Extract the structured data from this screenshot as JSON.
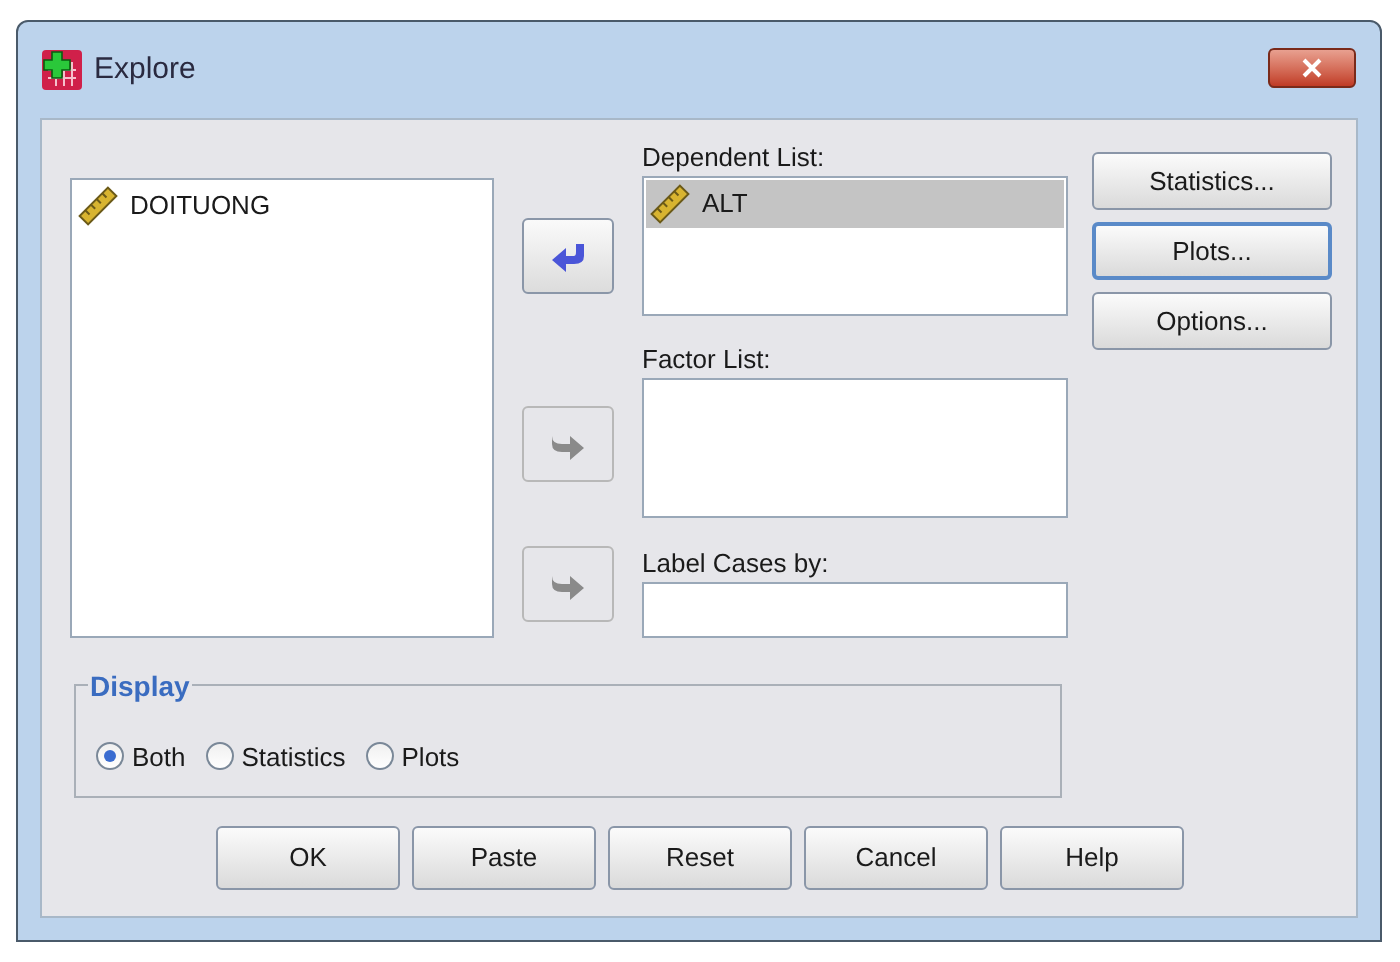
{
  "window": {
    "title": "Explore"
  },
  "source_list": {
    "items": [
      {
        "label": "DOITUONG",
        "selected": false
      }
    ]
  },
  "move_buttons": [
    {
      "kind": "back",
      "disabled": false
    },
    {
      "kind": "forward",
      "disabled": true
    },
    {
      "kind": "forward",
      "disabled": true
    }
  ],
  "dependent_list": {
    "label": "Dependent List:",
    "items": [
      {
        "label": "ALT",
        "selected": true
      }
    ]
  },
  "factor_list": {
    "label": "Factor List:"
  },
  "label_cases": {
    "label": "Label Cases by:"
  },
  "side_buttons": [
    {
      "label": "Statistics...",
      "focused": false
    },
    {
      "label": "Plots...",
      "focused": true
    },
    {
      "label": "Options...",
      "focused": false
    }
  ],
  "display": {
    "title": "Display",
    "options": [
      {
        "label": "Both",
        "selected": true
      },
      {
        "label": "Statistics",
        "selected": false
      },
      {
        "label": "Plots",
        "selected": false
      }
    ]
  },
  "buttons": [
    {
      "label": "OK"
    },
    {
      "label": "Paste"
    },
    {
      "label": "Reset"
    },
    {
      "label": "Cancel"
    },
    {
      "label": "Help"
    }
  ]
}
